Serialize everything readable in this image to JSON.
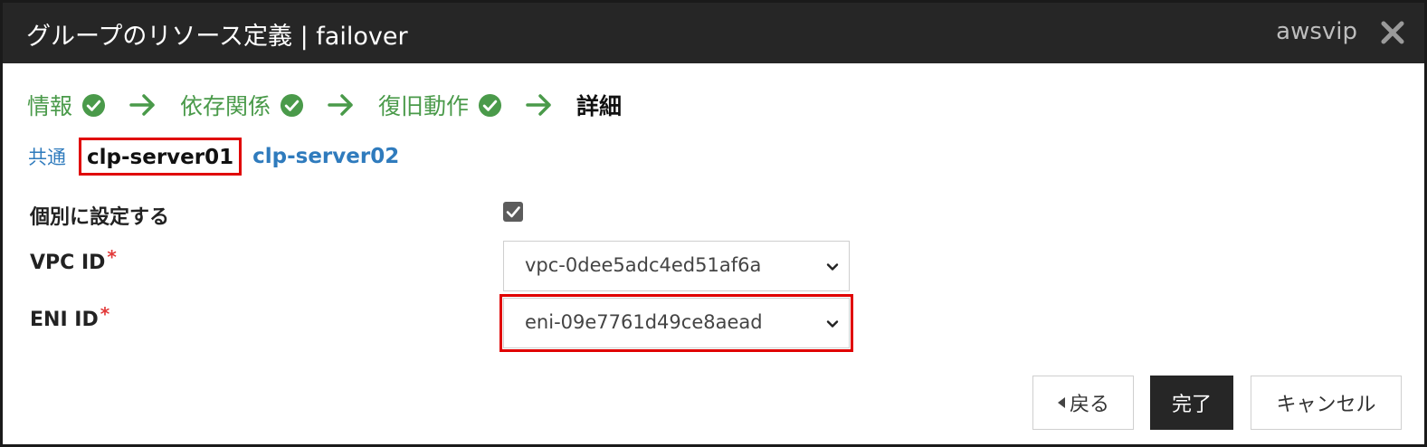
{
  "titlebar": {
    "title": "グループのリソース定義 | failover",
    "resource_name": "awsvip"
  },
  "steps": [
    {
      "label": "情報",
      "done": true
    },
    {
      "label": "依存関係",
      "done": true
    },
    {
      "label": "復旧動作",
      "done": true
    },
    {
      "label": "詳細",
      "done": false
    }
  ],
  "tabs": {
    "common": "共通",
    "active": "clp-server01",
    "other": "clp-server02"
  },
  "form": {
    "individual_label": "個別に設定する",
    "individual_checked": true,
    "vpc_label": "VPC ID",
    "vpc_value": "vpc-0dee5adc4ed51af6a",
    "eni_label": "ENI ID",
    "eni_value": "eni-09e7761d49ce8aead",
    "required_mark": "*"
  },
  "buttons": {
    "back": "戻る",
    "finish": "完了",
    "cancel": "キャンセル"
  },
  "colors": {
    "titlebar_bg": "#262626",
    "step_done": "#4a9a4a",
    "link": "#2f7bbd",
    "highlight": "#e00000",
    "required": "#e23a3a"
  }
}
